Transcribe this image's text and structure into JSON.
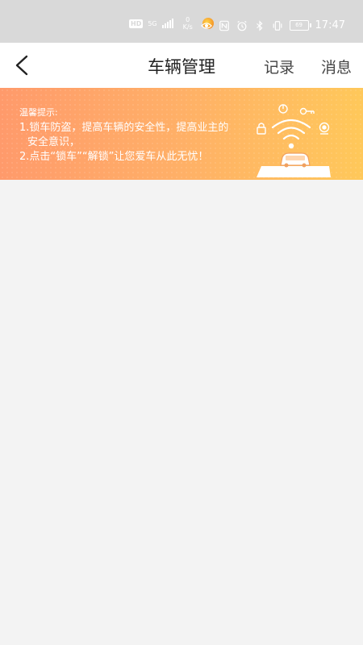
{
  "status_bar": {
    "hd": "HD",
    "network": "5G",
    "speed_value": "0",
    "speed_unit": "K/s",
    "battery": "69",
    "time": "17:47"
  },
  "header": {
    "title": "车辆管理",
    "records_label": "记录",
    "messages_label": "消息"
  },
  "banner": {
    "tips_title": "温馨提示:",
    "tip_1": "1.锁车防盗，提高车辆的安全性，提高业主的",
    "tip_1_cont": "安全意识，",
    "tip_2": "2.点击“锁车”“解锁”让您爱车从此无忧！"
  },
  "icons": [
    "back-arrow-icon",
    "eye-icon",
    "nfc-icon",
    "alarm-icon",
    "bluetooth-icon",
    "vibrate-icon",
    "battery-icon",
    "lock-icon",
    "key-icon",
    "wifi-signal-icon",
    "car-icon",
    "camera-icon"
  ]
}
